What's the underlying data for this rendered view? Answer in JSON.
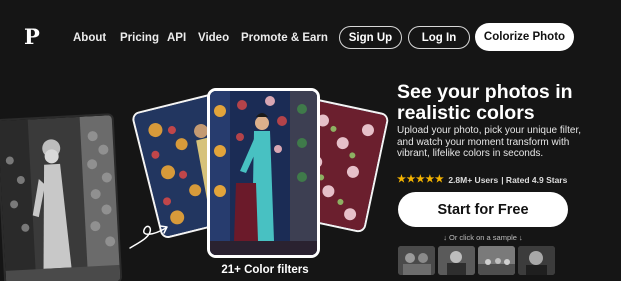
{
  "header": {
    "logo": "P",
    "nav": [
      "About",
      "Pricing",
      "API",
      "Video",
      "Promote & Earn"
    ],
    "sign_up": "Sign Up",
    "log_in": "Log In",
    "colorize": "Colorize Photo"
  },
  "hero": {
    "title": "See your photos in realistic colors",
    "description": "Upload your photo, pick your unique filter, and watch your moment transform with vibrant, lifelike colors in seconds.",
    "stars": "★★★★★",
    "users": "2.8M+ Users",
    "rated": "| Rated 4.9 Stars",
    "cta": "Start for Free",
    "sample_hint": "↓ Or click on a sample ↓",
    "filters_label": "21+ Color filters"
  },
  "colors": {
    "background": "#151515",
    "primary_button": "#ffffff",
    "star": "#f5b400"
  }
}
